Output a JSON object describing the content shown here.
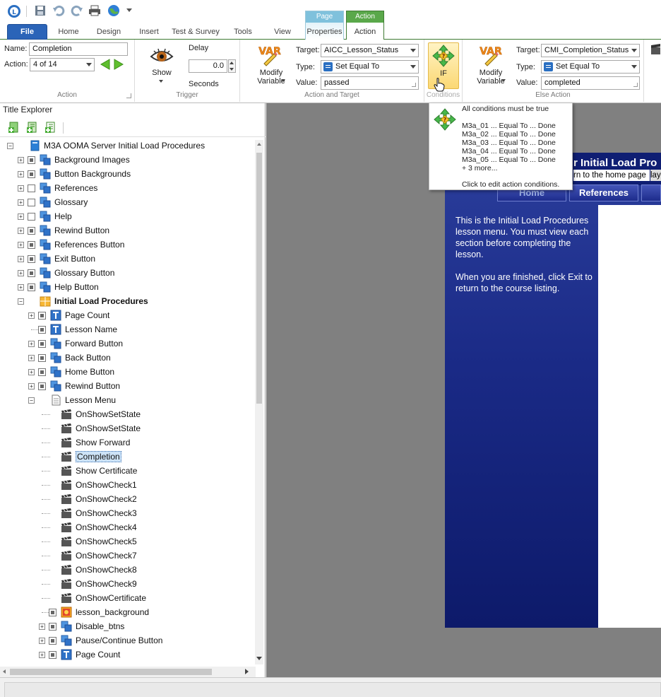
{
  "ribbon": {
    "tabs": {
      "file": "File",
      "home": "Home",
      "design": "Design",
      "insert": "Insert",
      "test_survey": "Test & Survey",
      "tools": "Tools",
      "view": "View",
      "page_ctx": "Page",
      "page_props": "Properties",
      "action_ctx": "Action",
      "action_tab": "Action"
    },
    "action_group": {
      "name_label": "Name:",
      "name_value": "Completion",
      "action_label": "Action:",
      "action_value": "4 of 14",
      "group_label": "Action"
    },
    "trigger_group": {
      "show_label": "Show",
      "delay_label": "Delay",
      "delay_value": "0.0",
      "seconds_label": "Seconds",
      "group_label": "Trigger"
    },
    "action_target_group": {
      "modify_label": "Modify Variable",
      "target_label": "Target:",
      "target_value": "AICC_Lesson_Status",
      "type_label": "Type:",
      "type_value": "Set Equal To",
      "value_label": "Value:",
      "value_value": "passed",
      "group_label": "Action and Target"
    },
    "conditions_group": {
      "if_label": "IF",
      "group_label": "Conditions"
    },
    "else_group": {
      "modify_label": "Modify Variable",
      "target_label": "Target:",
      "target_value": "CMI_Completion_Status",
      "type_label": "Type:",
      "type_value": "Set Equal To",
      "value_label": "Value:",
      "value_value": "completed",
      "group_label": "Else Action"
    }
  },
  "explorer": {
    "title": "Title Explorer",
    "tree": [
      {
        "label": "M3A OOMA Server Initial Load Procedures",
        "icon": "title-icon"
      },
      {
        "label": "Background Images",
        "icon": "group-icon"
      },
      {
        "label": "Button Backgrounds",
        "icon": "group-icon"
      },
      {
        "label": "References",
        "icon": "group-icon"
      },
      {
        "label": "Glossary",
        "icon": "group-icon"
      },
      {
        "label": "Help",
        "icon": "group-icon"
      },
      {
        "label": "Rewind Button",
        "icon": "group-icon"
      },
      {
        "label": "References Button",
        "icon": "group-icon"
      },
      {
        "label": "Exit Button",
        "icon": "group-icon"
      },
      {
        "label": "Glossary Button",
        "icon": "group-icon"
      },
      {
        "label": "Help Button",
        "icon": "group-icon"
      },
      {
        "label": "Initial Load Procedures",
        "icon": "chapter-icon"
      },
      {
        "label": "Page Count",
        "icon": "text-icon"
      },
      {
        "label": "Lesson Name",
        "icon": "text-icon"
      },
      {
        "label": "Forward Button",
        "icon": "group-icon"
      },
      {
        "label": "Back Button",
        "icon": "group-icon"
      },
      {
        "label": "Home Button",
        "icon": "group-icon"
      },
      {
        "label": "Rewind Button",
        "icon": "group-icon"
      },
      {
        "label": "Lesson Menu",
        "icon": "page-icon"
      },
      {
        "label": "OnShowSetState",
        "icon": "action-icon"
      },
      {
        "label": "OnShowSetState",
        "icon": "action-icon"
      },
      {
        "label": "Show Forward",
        "icon": "action-icon"
      },
      {
        "label": "Completion",
        "icon": "action-icon"
      },
      {
        "label": "Show Certificate",
        "icon": "action-icon"
      },
      {
        "label": "OnShowCheck1",
        "icon": "action-icon"
      },
      {
        "label": "OnShowCheck2",
        "icon": "action-icon"
      },
      {
        "label": "OnShowCheck3",
        "icon": "action-icon"
      },
      {
        "label": "OnShowCheck4",
        "icon": "action-icon"
      },
      {
        "label": "OnShowCheck5",
        "icon": "action-icon"
      },
      {
        "label": "OnShowCheck7",
        "icon": "action-icon"
      },
      {
        "label": "OnShowCheck8",
        "icon": "action-icon"
      },
      {
        "label": "OnShowCheck9",
        "icon": "action-icon"
      },
      {
        "label": "OnShowCertificate",
        "icon": "action-icon"
      },
      {
        "label": "lesson_background",
        "icon": "image-icon"
      },
      {
        "label": "Disable_btns",
        "icon": "group-icon"
      },
      {
        "label": "Pause/Continue Button",
        "icon": "group-icon"
      },
      {
        "label": "Page Count",
        "icon": "text-icon"
      }
    ]
  },
  "slide": {
    "header_title": "r Initial Load Pro",
    "header_subtitle": "rn to the home page",
    "header_overflow": "lay",
    "nav_home": "Home",
    "nav_references": "References",
    "body_text_1": "This is the Initial Load Procedures lesson menu. You must view each section before completing the lesson.",
    "body_text_2": "When you are finished, click Exit to return to the course listing."
  },
  "tooltip": {
    "heading": "All conditions must be true",
    "conditions": [
      "M3a_01 ... Equal To ... Done",
      "M3a_02 ... Equal To ... Done",
      "M3a_03 ... Equal To ... Done",
      "M3a_04 ... Equal To ... Done",
      "M3a_05 ... Equal To ... Done"
    ],
    "more": "+ 3 more...",
    "footer": "Click to edit action conditions."
  },
  "colors": {
    "accent_green": "#3f7a33",
    "file_blue": "#2b64b8",
    "slide_blue": "#1a2a86",
    "selection": "#cde3f7"
  }
}
